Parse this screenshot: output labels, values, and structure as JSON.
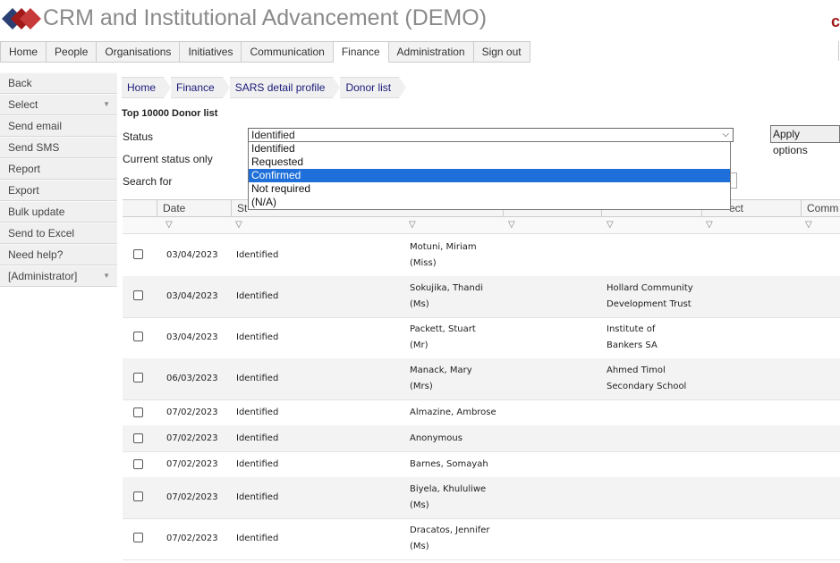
{
  "app": {
    "title": "CRM and Institutional Advancement (DEMO)",
    "corner_mark": "c"
  },
  "topnav": [
    "Home",
    "People",
    "Organisations",
    "Initiatives",
    "Communication",
    "Finance",
    "Administration",
    "Sign out"
  ],
  "sidebar": [
    {
      "label": "Back",
      "caret": false
    },
    {
      "label": "Select",
      "caret": true
    },
    {
      "label": "Send email",
      "caret": false
    },
    {
      "label": "Send SMS",
      "caret": false
    },
    {
      "label": "Report",
      "caret": false
    },
    {
      "label": "Export",
      "caret": false
    },
    {
      "label": "Bulk update",
      "caret": false
    },
    {
      "label": "Send to Excel",
      "caret": false
    },
    {
      "label": "Need help?",
      "caret": false
    },
    {
      "label": "[Administrator]",
      "caret": true
    }
  ],
  "breadcrumb": [
    "Home",
    "Finance",
    "SARS detail profile",
    "Donor list"
  ],
  "list_title": "Top 10000 Donor list",
  "filters": {
    "status_label": "Status",
    "current_status_label": "Current status only",
    "search_label": "Search for",
    "status_value": "Identified",
    "options": [
      "Identified",
      "Requested",
      "Confirmed",
      "Not required",
      "(N/A)"
    ],
    "highlighted_option": "Confirmed",
    "apply_label": "Apply options"
  },
  "grid": {
    "headers": [
      "Date",
      "St",
      "",
      "ect",
      "Comm"
    ],
    "rows": [
      {
        "date": "03/04/2023",
        "status": "Identified",
        "name": "Motuni, Miriam",
        "title": "(Miss)",
        "org1": "",
        "org2": ""
      },
      {
        "date": "03/04/2023",
        "status": "Identified",
        "name": "Sokujika, Thandi",
        "title": "(Ms)",
        "org1": "Hollard Community",
        "org2": "Development Trust"
      },
      {
        "date": "03/04/2023",
        "status": "Identified",
        "name": "Packett, Stuart",
        "title": "(Mr)",
        "org1": "Institute of",
        "org2": "Bankers SA"
      },
      {
        "date": "06/03/2023",
        "status": "Identified",
        "name": "Manack, Mary",
        "title": "(Mrs)",
        "org1": "Ahmed Timol",
        "org2": "Secondary School"
      },
      {
        "date": "07/02/2023",
        "status": "Identified",
        "name": "Almazine, Ambrose",
        "title": "",
        "org1": "",
        "org2": ""
      },
      {
        "date": "07/02/2023",
        "status": "Identified",
        "name": "Anonymous",
        "title": "",
        "org1": "",
        "org2": ""
      },
      {
        "date": "07/02/2023",
        "status": "Identified",
        "name": "Barnes, Somayah",
        "title": "",
        "org1": "",
        "org2": ""
      },
      {
        "date": "07/02/2023",
        "status": "Identified",
        "name": "Biyela, Khululiwe",
        "title": "(Ms)",
        "org1": "",
        "org2": ""
      },
      {
        "date": "07/02/2023",
        "status": "Identified",
        "name": "Dracatos, Jennifer",
        "title": "(Ms)",
        "org1": "",
        "org2": ""
      }
    ]
  },
  "colors": {
    "accent_red": "#a01a1a",
    "logo_blue": "#2b3f73",
    "selection": "#1e6fd9"
  },
  "icons": {
    "dropdown": "chevron-down-icon",
    "filter": "filter-icon",
    "logo": "diamond-logo-icon"
  }
}
